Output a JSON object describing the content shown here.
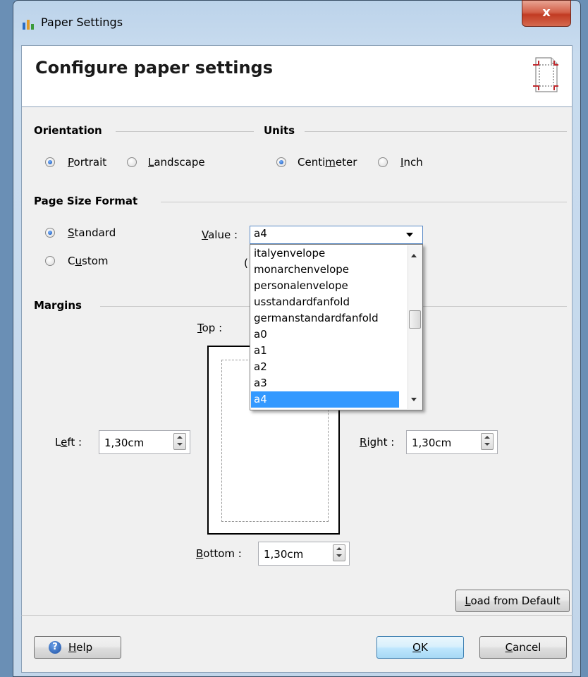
{
  "window": {
    "title": "Paper Settings",
    "close_glyph": "x"
  },
  "header": {
    "title": "Configure paper settings",
    "icon": "page-margin-icon"
  },
  "orientation": {
    "label": "Orientation",
    "portrait": "Portrait",
    "landscape": "Landscape",
    "selected": "portrait"
  },
  "units": {
    "label": "Units",
    "centimeter": "Centimeter",
    "inch": "Inch",
    "selected": "centimeter"
  },
  "page_size": {
    "label": "Page Size Format",
    "standard": "Standard",
    "custom": "Custom",
    "selected": "standard",
    "value_label": "Value :",
    "value": "a4",
    "options": [
      "italyenvelope",
      "monarchenvelope",
      "personalenvelope",
      "usstandardfanfold",
      "germanstandardfanfold",
      "a0",
      "a1",
      "a2",
      "a3",
      "a4"
    ],
    "hidden_glyph": "("
  },
  "margins": {
    "label": "Margins",
    "top_label": "Top :",
    "left_label": "Left :",
    "left_value": "1,30cm",
    "right_label": "Right :",
    "right_value": "1,30cm",
    "bottom_label": "Bottom :",
    "bottom_value": "1,30cm"
  },
  "buttons": {
    "load_default": "Load from Default",
    "help": "Help",
    "ok": "OK",
    "cancel": "Cancel"
  },
  "colors": {
    "selection": "#3399ff",
    "accent": "#5a8ac6"
  }
}
